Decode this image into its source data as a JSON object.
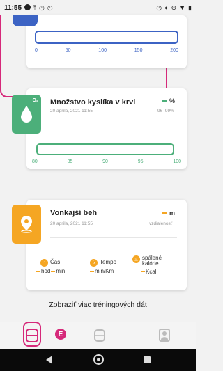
{
  "status_bar": {
    "time": "11:55",
    "left_icons": [
      "record-icon",
      "upload-icon",
      "alarm-icon",
      "alarm-clock-icon"
    ],
    "right_icons": [
      "alarm-icon",
      "vibrate-icon",
      "dnd-icon",
      "wifi-icon",
      "battery-icon"
    ]
  },
  "top_card": {
    "ticks": [
      "0",
      "50",
      "100",
      "150",
      "200"
    ]
  },
  "oxygen_card": {
    "badge": "O₂",
    "title": "Množstvo kyslíka v krvi",
    "date": "20 apríla, 2021 11:55",
    "unit": "%",
    "range": "96–99%",
    "ticks": [
      "80",
      "85",
      "90",
      "95",
      "100"
    ]
  },
  "run_card": {
    "title": "Vonkajší beh",
    "date": "20 apríla, 2021 11:55",
    "unit": "m",
    "unit_sub": "vzdialenosť",
    "metrics": [
      {
        "label": "Čas",
        "values": [
          "hod",
          "min"
        ]
      },
      {
        "label": "Tempo",
        "values": [
          "min/Km"
        ]
      },
      {
        "label": "spálené kalórie",
        "values": [
          "Kcal"
        ]
      }
    ]
  },
  "more_link": "Zobraziť viac tréningových dát",
  "annotation_badge": "E",
  "colors": {
    "blue": "#3c63c4",
    "green": "#4caf7a",
    "orange": "#f5a623",
    "highlight": "#d6297a"
  }
}
